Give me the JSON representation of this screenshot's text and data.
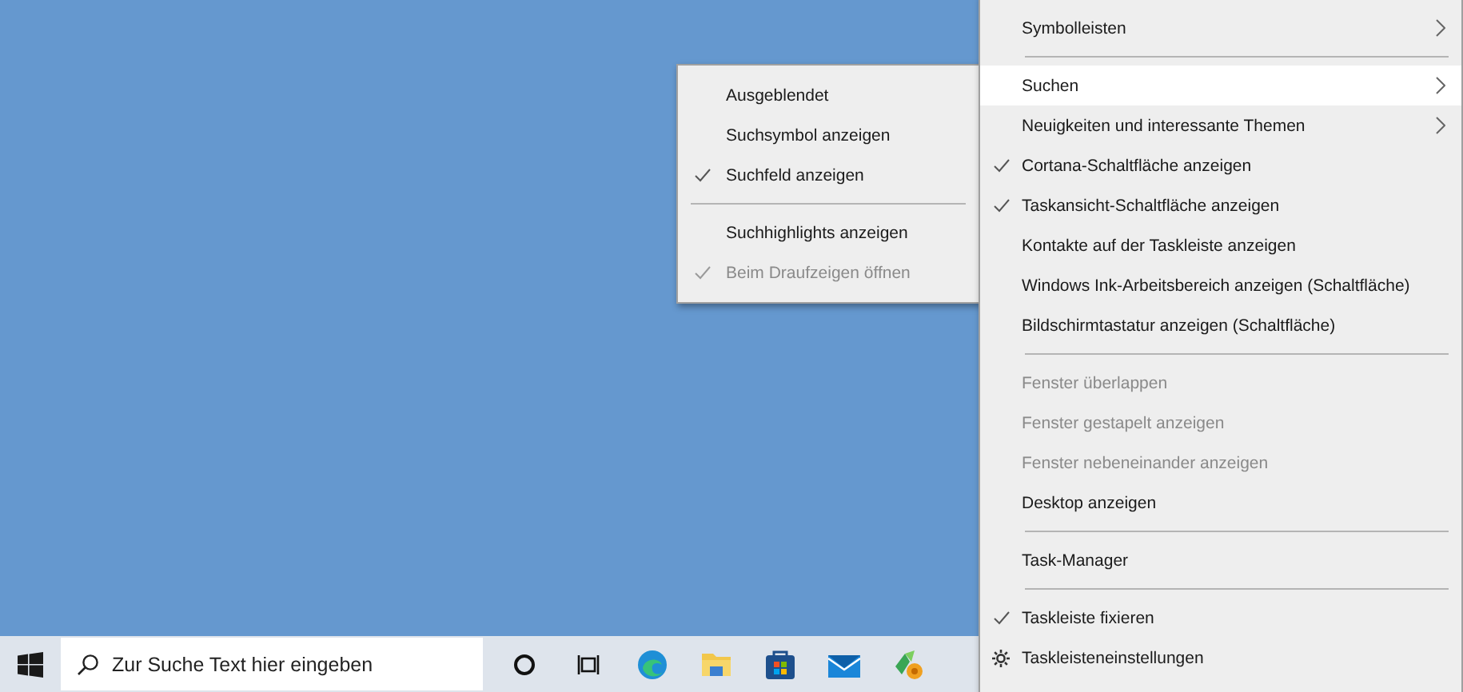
{
  "context_menu": {
    "groups": [
      [
        {
          "label": "Symbolleisten",
          "kind": "option",
          "checked": false,
          "disabled": false,
          "submenu": true,
          "selected": false
        }
      ],
      [
        {
          "label": "Suchen",
          "kind": "option",
          "checked": false,
          "disabled": false,
          "submenu": true,
          "selected": true
        },
        {
          "label": "Neuigkeiten und interessante Themen",
          "kind": "option",
          "checked": false,
          "disabled": false,
          "submenu": true,
          "selected": false
        },
        {
          "label": "Cortana-Schaltfläche anzeigen",
          "kind": "option",
          "checked": true,
          "disabled": false,
          "submenu": false,
          "selected": false
        },
        {
          "label": "Taskansicht-Schaltfläche anzeigen",
          "kind": "option",
          "checked": true,
          "disabled": false,
          "submenu": false,
          "selected": false
        },
        {
          "label": "Kontakte auf der Taskleiste anzeigen",
          "kind": "option",
          "checked": false,
          "disabled": false,
          "submenu": false,
          "selected": false
        },
        {
          "label": "Windows Ink-Arbeitsbereich anzeigen (Schaltfläche)",
          "kind": "option",
          "checked": false,
          "disabled": false,
          "submenu": false,
          "selected": false
        },
        {
          "label": "Bildschirmtastatur anzeigen (Schaltfläche)",
          "kind": "option",
          "checked": false,
          "disabled": false,
          "submenu": false,
          "selected": false
        }
      ],
      [
        {
          "label": "Fenster überlappen",
          "kind": "option",
          "checked": false,
          "disabled": true,
          "submenu": false,
          "selected": false
        },
        {
          "label": "Fenster gestapelt anzeigen",
          "kind": "option",
          "checked": false,
          "disabled": true,
          "submenu": false,
          "selected": false
        },
        {
          "label": "Fenster nebeneinander anzeigen",
          "kind": "option",
          "checked": false,
          "disabled": true,
          "submenu": false,
          "selected": false
        },
        {
          "label": "Desktop anzeigen",
          "kind": "option",
          "checked": false,
          "disabled": false,
          "submenu": false,
          "selected": false
        }
      ],
      [
        {
          "label": "Task-Manager",
          "kind": "option",
          "checked": false,
          "disabled": false,
          "submenu": false,
          "selected": false
        }
      ],
      [
        {
          "label": "Taskleiste fixieren",
          "kind": "option",
          "checked": true,
          "disabled": false,
          "submenu": false,
          "selected": false
        },
        {
          "label": "Taskleisteneinstellungen",
          "kind": "settings",
          "checked": false,
          "disabled": false,
          "submenu": false,
          "selected": false
        }
      ]
    ]
  },
  "submenu": {
    "groups": [
      [
        {
          "label": "Ausgeblendet",
          "checked": false,
          "disabled": false
        },
        {
          "label": "Suchsymbol anzeigen",
          "checked": false,
          "disabled": false
        },
        {
          "label": "Suchfeld anzeigen",
          "checked": true,
          "disabled": false
        }
      ],
      [
        {
          "label": "Suchhighlights anzeigen",
          "checked": false,
          "disabled": false
        },
        {
          "label": "Beim Draufzeigen öffnen",
          "checked": true,
          "disabled": true
        }
      ]
    ]
  },
  "taskbar": {
    "search": {
      "placeholder": "Zur Suche Text hier eingeben"
    }
  }
}
